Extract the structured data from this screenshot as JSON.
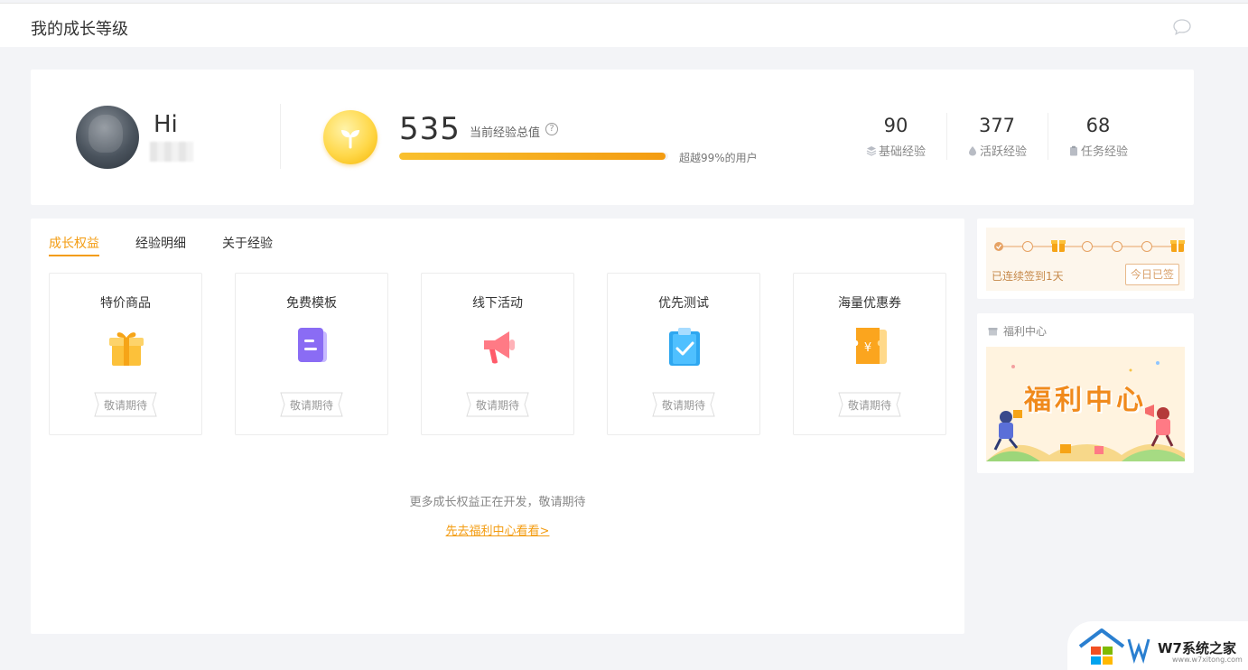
{
  "header": {
    "title": "我的成长等级",
    "message_icon": "chat-bubble-icon"
  },
  "profile": {
    "greeting": "Hi",
    "avatar": "user-avatar-image"
  },
  "experience": {
    "value": "535",
    "label": "当前经验总值",
    "help_icon": "question-circle-icon",
    "help_glyph": "?",
    "progress_percent": 99,
    "rank_text": "超越99%的用户"
  },
  "stats": [
    {
      "value": "90",
      "label": "基础经验",
      "icon": "layers-icon"
    },
    {
      "value": "377",
      "label": "活跃经验",
      "icon": "drop-icon"
    },
    {
      "value": "68",
      "label": "任务经验",
      "icon": "clipboard-icon"
    }
  ],
  "tabs": [
    {
      "label": "成长权益",
      "active": true
    },
    {
      "label": "经验明细",
      "active": false
    },
    {
      "label": "关于经验",
      "active": false
    }
  ],
  "benefits": [
    {
      "name": "特价商品",
      "tag": "敬请期待",
      "icon": "gift-icon"
    },
    {
      "name": "免费模板",
      "tag": "敬请期待",
      "icon": "document-icon"
    },
    {
      "name": "线下活动",
      "tag": "敬请期待",
      "icon": "megaphone-icon"
    },
    {
      "name": "优先测试",
      "tag": "敬请期待",
      "icon": "clipboard-check-icon"
    },
    {
      "name": "海量优惠券",
      "tag": "敬请期待",
      "icon": "coupon-icon"
    }
  ],
  "footer_note": "更多成长权益正在开发，敬请期待",
  "welfare_link": "先去福利中心看看>",
  "signin": {
    "streak_text": "已连续签到1天",
    "button_label": "今日已签"
  },
  "welfare_center": {
    "title": "福利中心",
    "banner_text": "福利中心",
    "icon": "gift-small-icon"
  },
  "watermark": {
    "logo_text": "W7系统之家",
    "url_text": "www.w7xitong.com"
  },
  "colors": {
    "accent": "#f39c12",
    "page_bg": "#f3f4f7"
  }
}
